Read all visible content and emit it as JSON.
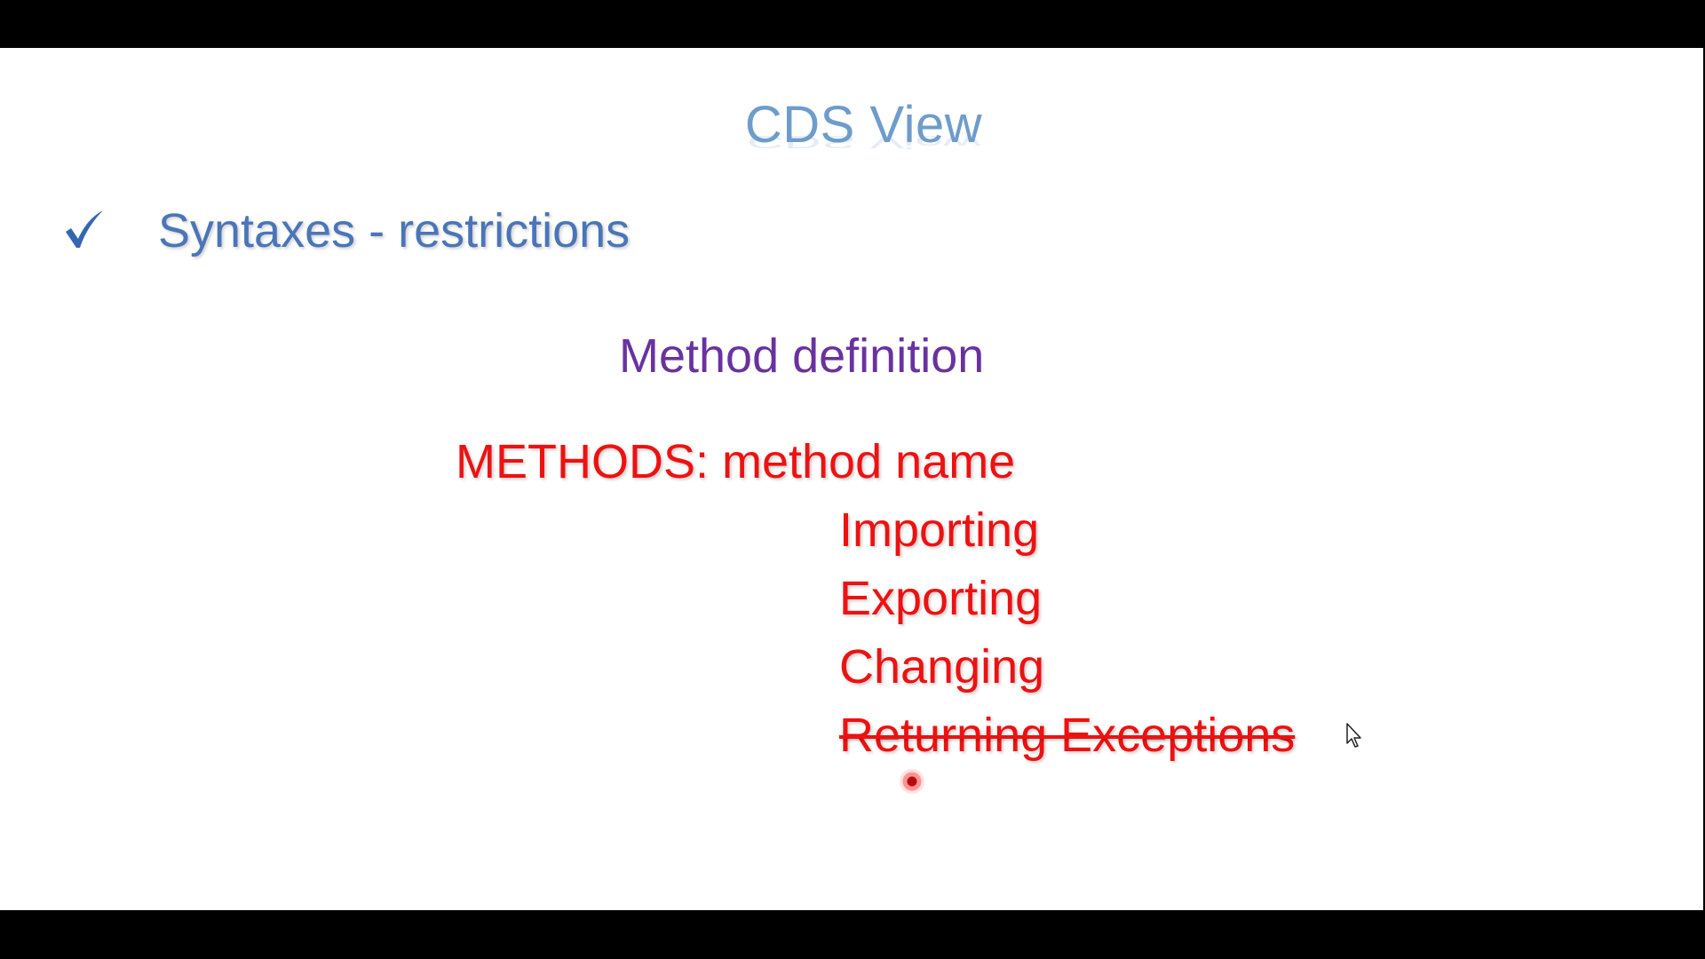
{
  "slide": {
    "title": "CDS View",
    "bullet": {
      "icon": "checkmark-icon",
      "text": "Syntaxes - restrictions"
    },
    "subheading": "Method definition",
    "methods": {
      "header": "METHODS: method name",
      "params": [
        "Importing",
        "Exporting",
        "Changing"
      ],
      "struck_line": "Returning  Exceptions"
    }
  },
  "colors": {
    "title": "#6e9ccb",
    "bullet": "#4a76b8",
    "subheading": "#6a32a0",
    "methods": "#ee1111",
    "letterbox": "#000000",
    "background": "#ffffff"
  }
}
